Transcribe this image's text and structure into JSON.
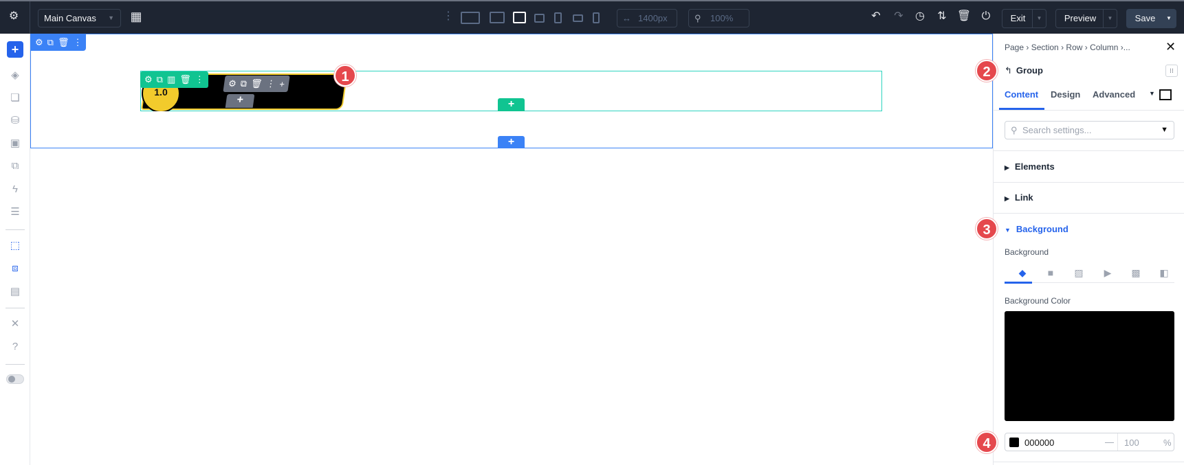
{
  "topbar": {
    "settings_icon": "gear-icon",
    "canvas_select": "Main Canvas",
    "width_value": "1400px",
    "zoom_value": "100%",
    "exit_label": "Exit",
    "preview_label": "Preview",
    "save_label": "Save"
  },
  "canvas": {
    "module_label": "1.0",
    "annotations": [
      "1",
      "2",
      "3",
      "4"
    ]
  },
  "panel": {
    "breadcrumb": [
      "Page",
      "Section",
      "Row",
      "Column",
      "..."
    ],
    "title": "Group",
    "tabs": [
      "Content",
      "Design",
      "Advanced"
    ],
    "active_tab": "Content",
    "search_placeholder": "Search settings...",
    "sections": [
      "Elements",
      "Link",
      "Background"
    ],
    "background_label": "Background",
    "background_color_label": "Background Color",
    "color_hex": "000000",
    "opacity": "100",
    "opacity_unit": "%",
    "color_value": "#000000"
  },
  "colors": {
    "accent": "#2563eb",
    "row": "#10c491",
    "topbar": "#1e2532",
    "badge": "#e5484d",
    "module_circle": "#f2cb2c"
  }
}
